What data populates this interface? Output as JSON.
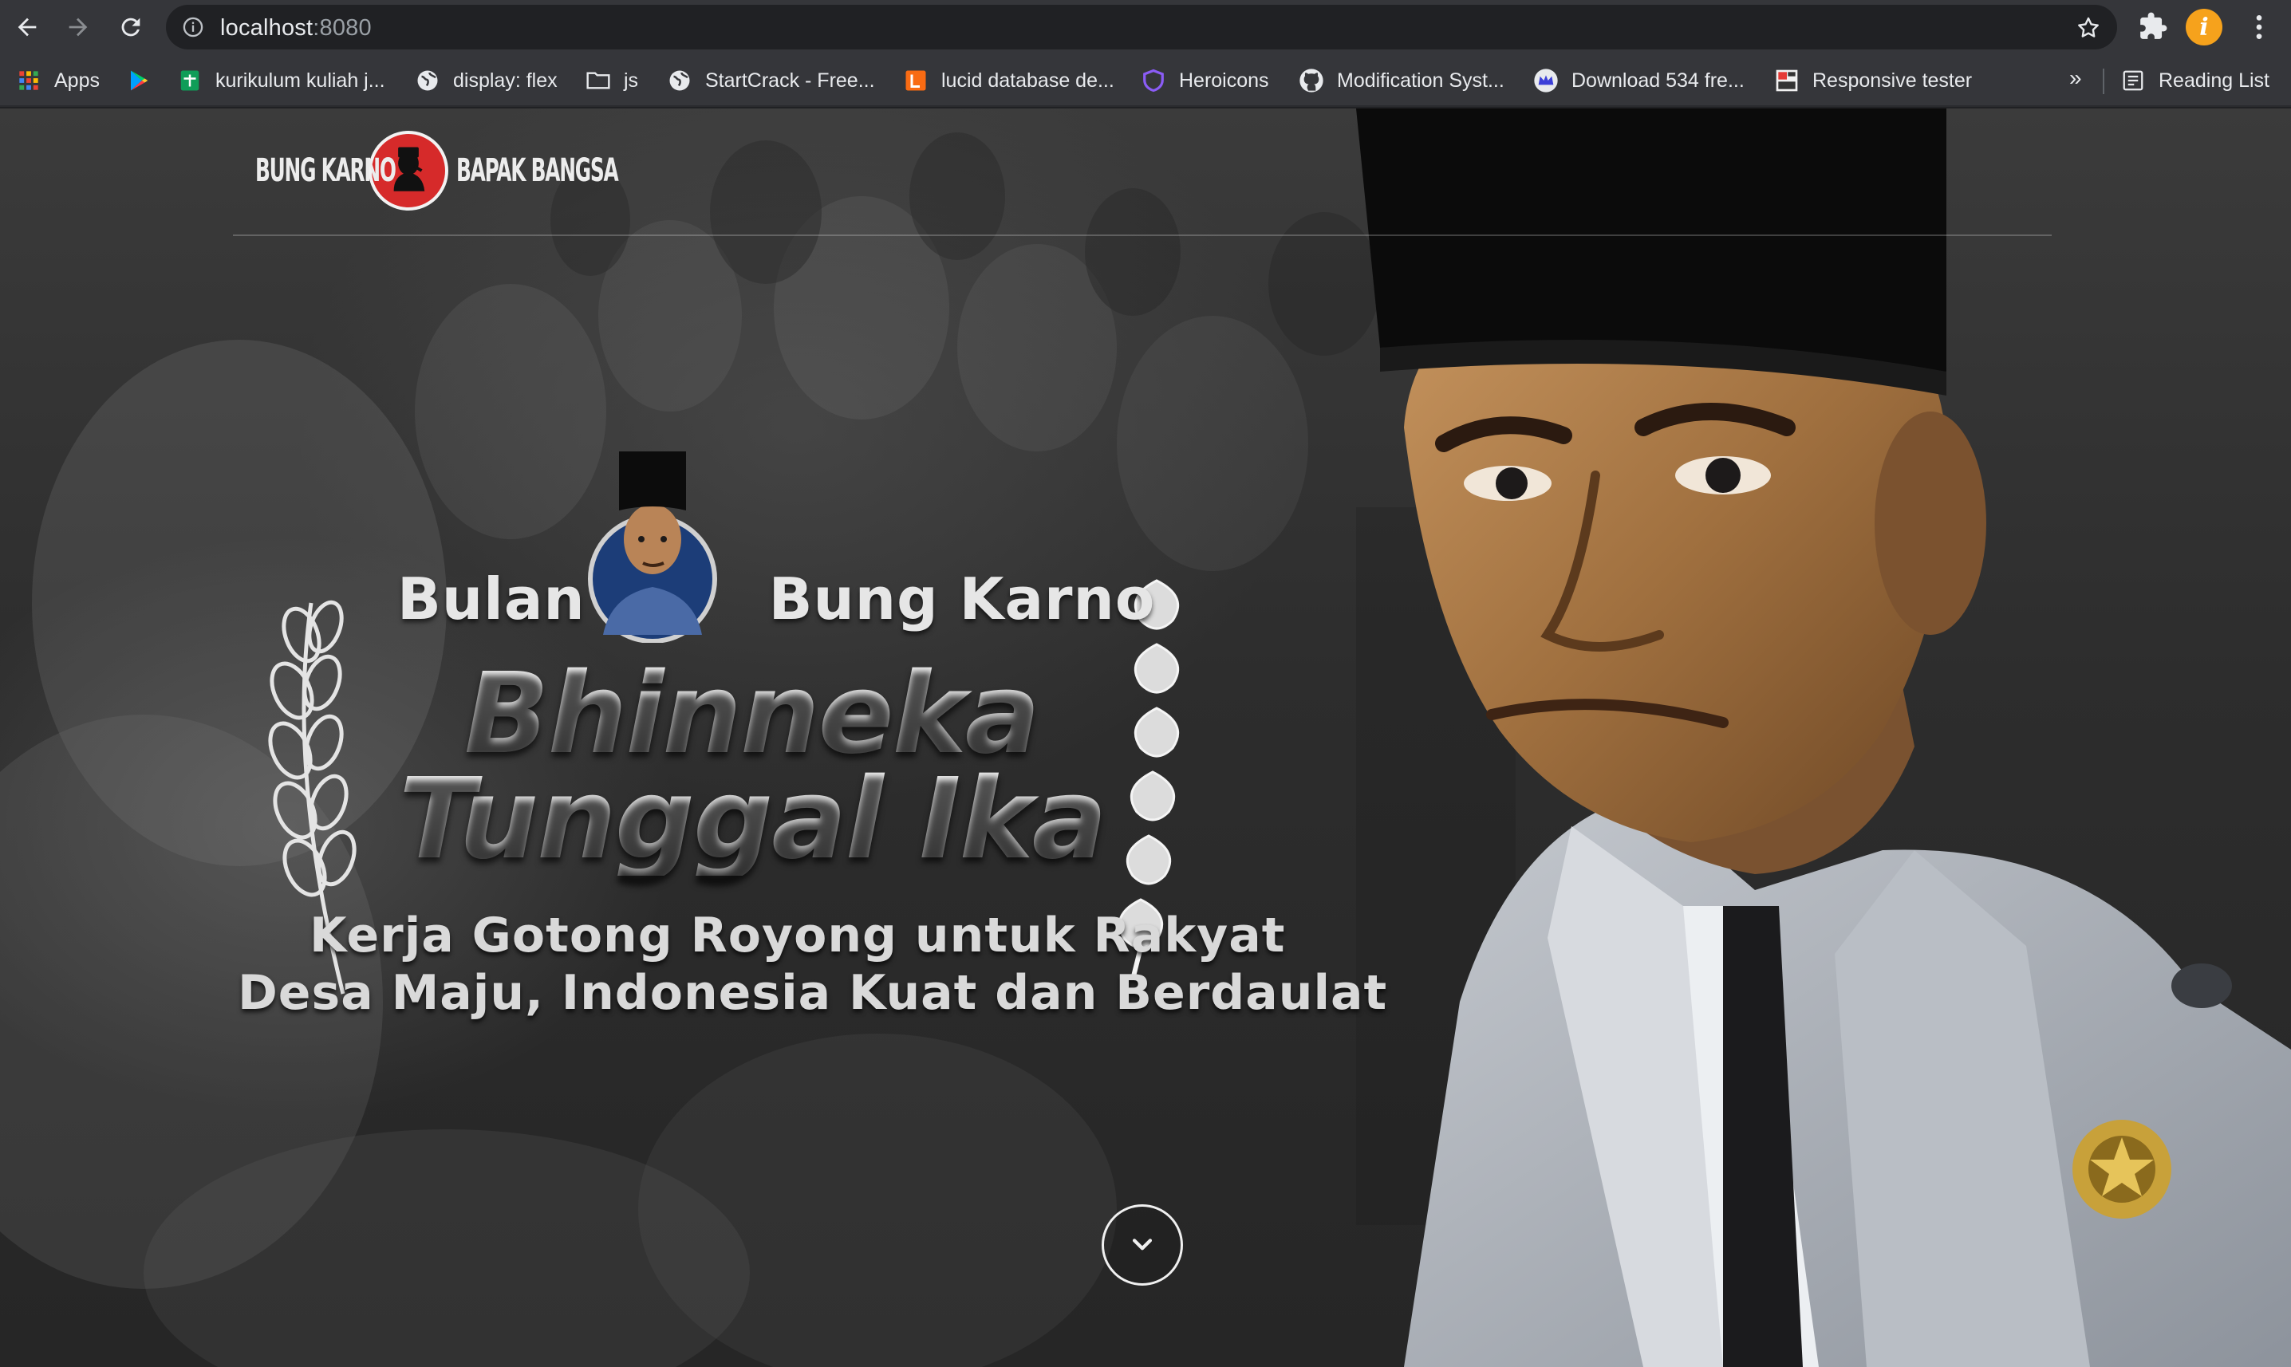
{
  "browser": {
    "url_host": "localhost",
    "url_port": ":8080",
    "bookmarks": [
      {
        "label": "Apps",
        "icon": "apps-grid-icon"
      },
      {
        "label": "",
        "icon": "play-store-icon"
      },
      {
        "label": "kurikulum kuliah j...",
        "icon": "sheets-icon"
      },
      {
        "label": "display: flex",
        "icon": "globe-icon"
      },
      {
        "label": "js",
        "icon": "folder-icon"
      },
      {
        "label": "StartCrack - Free...",
        "icon": "globe-icon"
      },
      {
        "label": "lucid database de...",
        "icon": "lucid-icon"
      },
      {
        "label": "Heroicons",
        "icon": "heroicons-icon"
      },
      {
        "label": "Modification Syst...",
        "icon": "github-icon"
      },
      {
        "label": "Download 534 fre...",
        "icon": "crown-icon"
      },
      {
        "label": "Responsive tester",
        "icon": "responsive-icon"
      }
    ],
    "more_label": "»",
    "reading_list_label": "Reading List",
    "profile_initial": "i"
  },
  "page": {
    "logo_left": "BUNG KARNO",
    "logo_right": "BAPAK BANGSA",
    "hero_word_left": "Bulan",
    "hero_word_right": "Bung Karno",
    "hero_title_line1": "Bhinneka",
    "hero_title_line2": "Tunggal Ika",
    "subtitle_line1": "Kerja Gotong Royong untuk Rakyat",
    "subtitle_line2": "Desa Maju, Indonesia Kuat dan Berdaulat"
  },
  "colors": {
    "chrome_bg": "#35363a",
    "omnibox_bg": "#202124",
    "logo_red": "#d62a2a",
    "profile_orange": "#f6a21c"
  }
}
